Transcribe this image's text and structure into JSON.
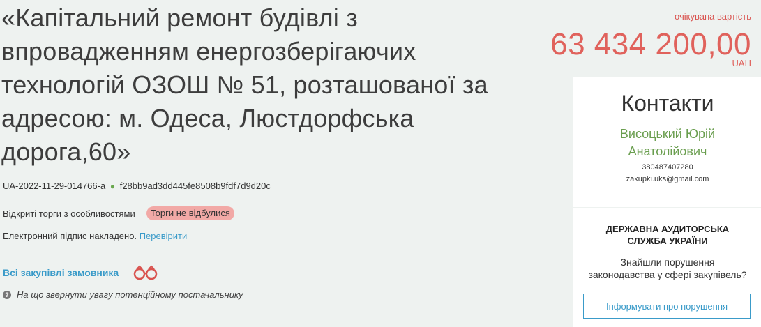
{
  "tender": {
    "title": "«Капітальний ремонт будівлі з впровадженням енергозберігаючих технологій ОЗОШ № 51, розташованої за адресою: м. Одеса, Люстдорфська дорога,60»",
    "id": "UA-2022-11-29-014766-a",
    "dot": "●",
    "hash": "f28bb9ad3dd445fe8508b9fdf7d9d20c",
    "procedure_type": "Відкриті торги з особливостями",
    "status_badge": "Торги не відбулися",
    "signature_text": "Електронний підпис накладено.",
    "signature_link": "Перевірити",
    "all_purchases_link": "Всі закупівлі замовника",
    "attention_text": "На що звернути увагу потенційному постачальнику",
    "attention_icon": "?"
  },
  "price": {
    "label": "очікувана вартість",
    "amount": "63 434 200,00",
    "currency": "UAH"
  },
  "contacts": {
    "heading": "Контакти",
    "name_line1": "Висоцький Юрій",
    "name_line2": "Анатолійович",
    "phone": "380487407280",
    "email": "zakupki.uks@gmail.com"
  },
  "audit": {
    "title_line1": "ДЕРЖАВНА АУДИТОРСЬКА",
    "title_line2": "СЛУЖБА УКРАЇНИ",
    "text_line1": "Знайшли порушення",
    "text_line2": "законодавства у сфері закупівель?",
    "button_label": "Інформувати про порушення"
  },
  "colors": {
    "accent_link": "#3a9bc9",
    "price_red": "#e0625c",
    "contact_green": "#6a9e4f",
    "badge_bg": "#f2a9a6",
    "background": "#eef2f0"
  },
  "icons": {
    "binoculars": "binoculars-icon",
    "question": "question-circle-icon"
  }
}
